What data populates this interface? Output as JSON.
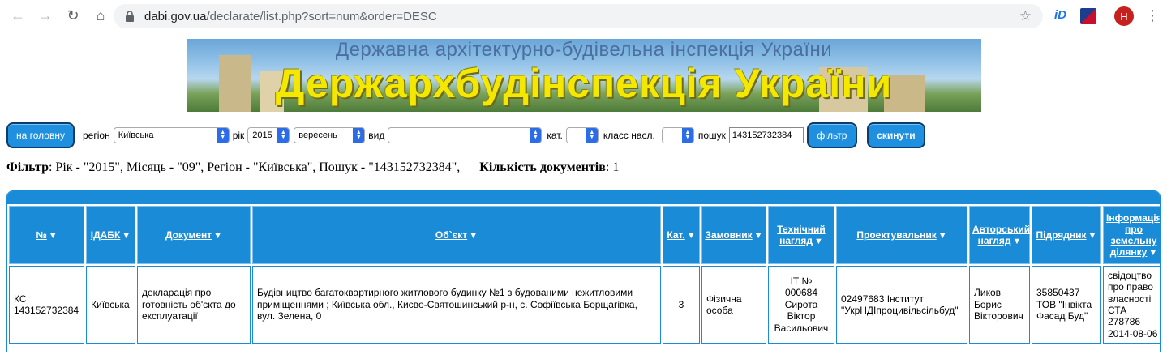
{
  "browser": {
    "url_host": "dabi.gov.ua",
    "url_path": "/declarate/list.php?sort=num&order=DESC",
    "extension_id_label": "iD",
    "avatar_letter": "H"
  },
  "banner": {
    "subtitle": "Державна архітектурно-будівельна інспекція України",
    "title": "Держархбудінспекція України"
  },
  "filters": {
    "home_button": "на головну",
    "region_label": "регіон",
    "region_value": "Київська",
    "year_label": "рік",
    "year_value": "2015",
    "month_value": "вересень",
    "type_label": "вид",
    "type_value": "",
    "cat_label": "кат.",
    "cat_value": "",
    "class_label": "класс насл.",
    "class_value": "",
    "search_label": "пошук",
    "search_value": "143152732384",
    "filter_button": "фільтр",
    "reset_button": "скинути"
  },
  "summary": {
    "filter_label": "Фільтр",
    "filter_text": ": Рік - \"2015\", Місяць - \"09\", Регіон - \"Київська\", Пошук - \"143152732384\",",
    "count_label": "Кількість документів",
    "count_value": ": 1"
  },
  "table": {
    "headers": [
      "№",
      "ІДАБК",
      "Документ",
      "Об`єкт",
      "Кат.",
      "Замовник",
      "Технічний нагляд",
      "Проектувальник",
      "Авторський нагляд",
      "Підрядник",
      "Інформація про земельну ділянку"
    ],
    "sort_arrow": "▼",
    "rows": [
      [
        "КС 143152732384",
        "Київська",
        "декларація про готовність об'єкта до експлуатації",
        "Будівництво багатоквартирного житлового будинку №1 з будованими нежитловими приміщеннями ; Київська обл., Києво-Святошинський р-н, с. Софіївська Борщагівка, вул. Зелена, 0",
        "3",
        "Фізична особа",
        "ІТ № 000684 Сирота Віктор Васильович",
        "02497683 Інститут \"УкрНДІпроцивільсільбуд\"",
        "Ликов Борис Вікторович",
        "35850437 ТОВ \"Інвікта Фасад Буд\"",
        "свідоцтво про право власності СТА 278786 2014-08-06"
      ]
    ]
  }
}
